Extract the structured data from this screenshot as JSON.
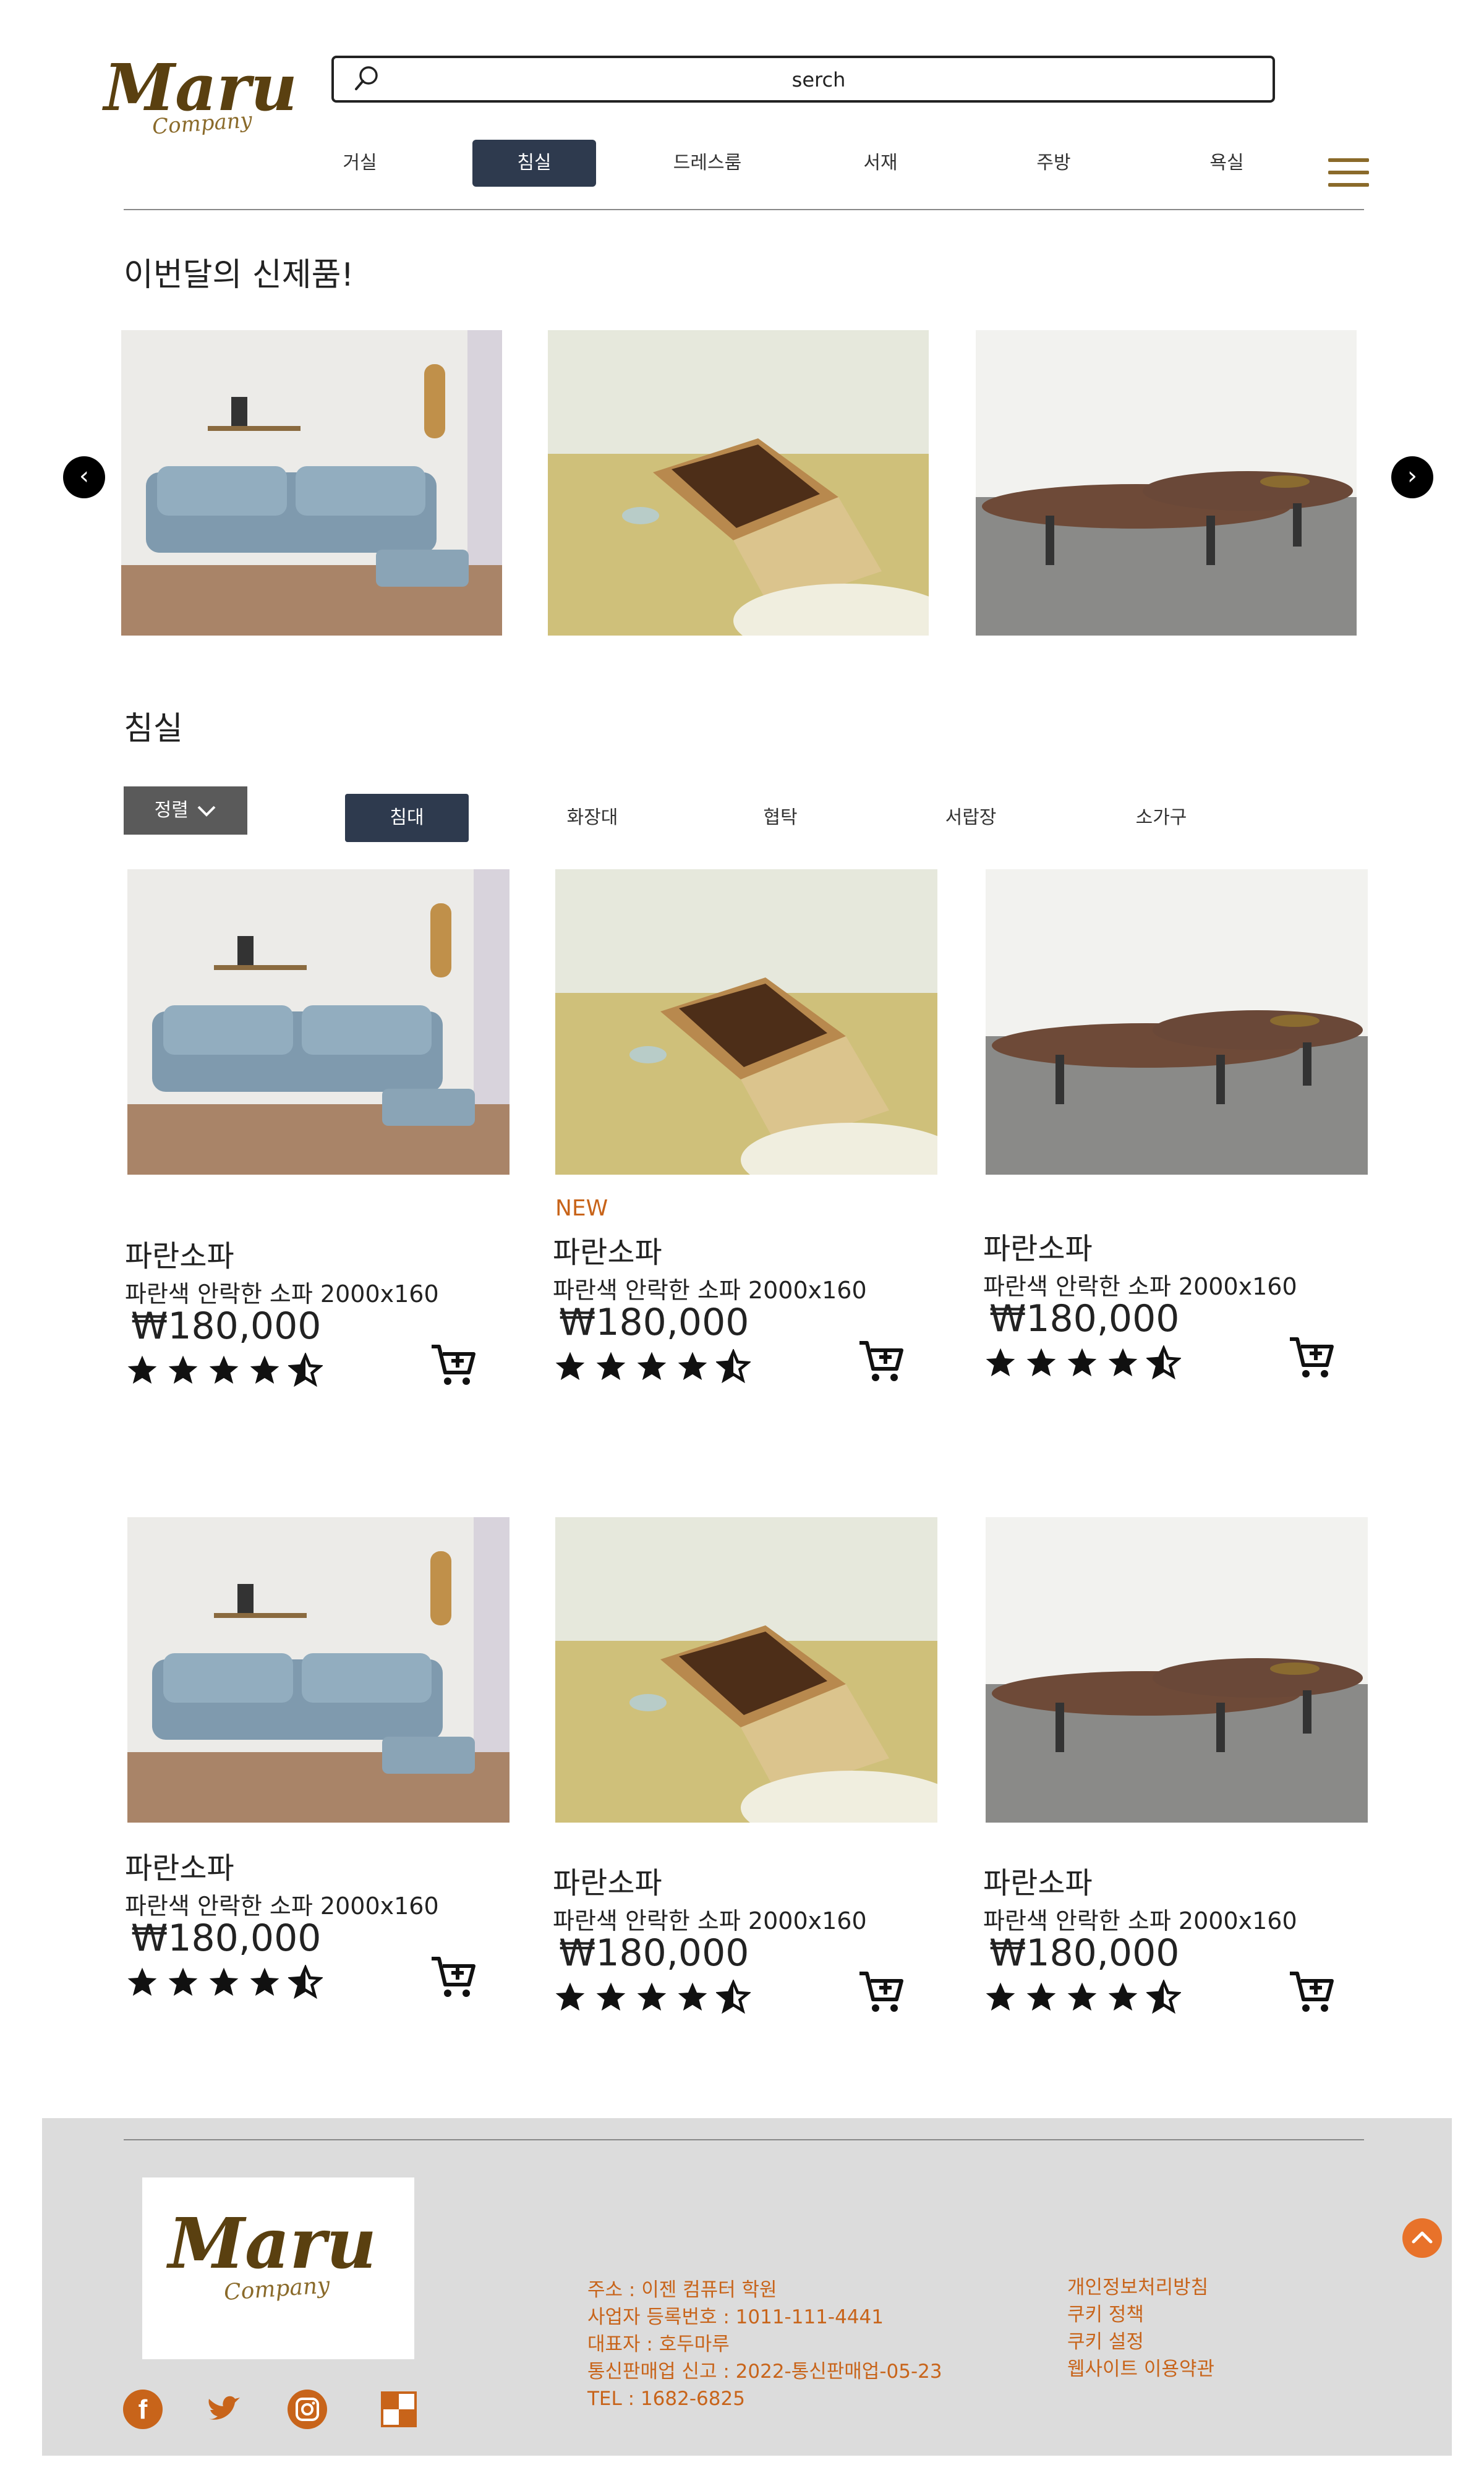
{
  "brand": {
    "logo_main": "Maru",
    "logo_sub": "Company"
  },
  "search": {
    "placeholder": "serch"
  },
  "nav": {
    "items": [
      "거실",
      "침실",
      "드레스룸",
      "서재",
      "주방",
      "욕실"
    ],
    "active": "침실"
  },
  "slider": {
    "title": "이번달의 신제품!",
    "slides": [
      "blue-sofa-photo",
      "wooden-table-photo",
      "oval-coffee-table-photo"
    ]
  },
  "category": {
    "title": "침실",
    "sort_label": "정렬",
    "tabs": [
      "침대",
      "화장대",
      "협탁",
      "서랍장",
      "소가구"
    ],
    "active": "침대"
  },
  "products": [
    {
      "image": "blue-sofa-photo",
      "badge": "",
      "name": "파란소파",
      "desc": "파란색 안락한 소파 2000x160",
      "price": "₩180,000",
      "rating": 4.5
    },
    {
      "image": "wooden-table-photo",
      "badge": "NEW",
      "name": "파란소파",
      "desc": "파란색 안락한 소파 2000x160",
      "price": "₩180,000",
      "rating": 4.5
    },
    {
      "image": "oval-coffee-table-photo",
      "badge": "",
      "name": "파란소파",
      "desc": "파란색 안락한 소파 2000x160",
      "price": "₩180,000",
      "rating": 4.5
    },
    {
      "image": "blue-sofa-photo",
      "badge": "",
      "name": "파란소파",
      "desc": "파란색 안락한 소파 2000x160",
      "price": "₩180,000",
      "rating": 4.5
    },
    {
      "image": "wooden-table-photo",
      "badge": "",
      "name": "파란소파",
      "desc": "파란색 안락한 소파 2000x160",
      "price": "₩180,000",
      "rating": 4.5
    },
    {
      "image": "oval-coffee-table-photo",
      "badge": "",
      "name": "파란소파",
      "desc": "파란색 안락한 소파 2000x160",
      "price": "₩180,000",
      "rating": 4.5
    }
  ],
  "footer": {
    "info": [
      "주소 : 이젠 컴퓨터 학원",
      "사업자 등록번호 : 1011-111-4441",
      "대표자 : 호두마루",
      "통신판매업 신고 : 2022-통신판매업-05-23",
      "TEL : 1682-6825"
    ],
    "links": [
      "개인정보처리방침",
      "쿠키 정책",
      "쿠키 설정",
      "웹사이트 이용약관"
    ],
    "social": [
      "facebook-icon",
      "twitter-icon",
      "instagram-icon",
      "blog-icon"
    ]
  },
  "colors": {
    "nav_active": "#2e3a4e",
    "accent_orange": "#c8641a",
    "logo_brown": "#5a4010",
    "footer_bg": "#dcdcdc"
  }
}
